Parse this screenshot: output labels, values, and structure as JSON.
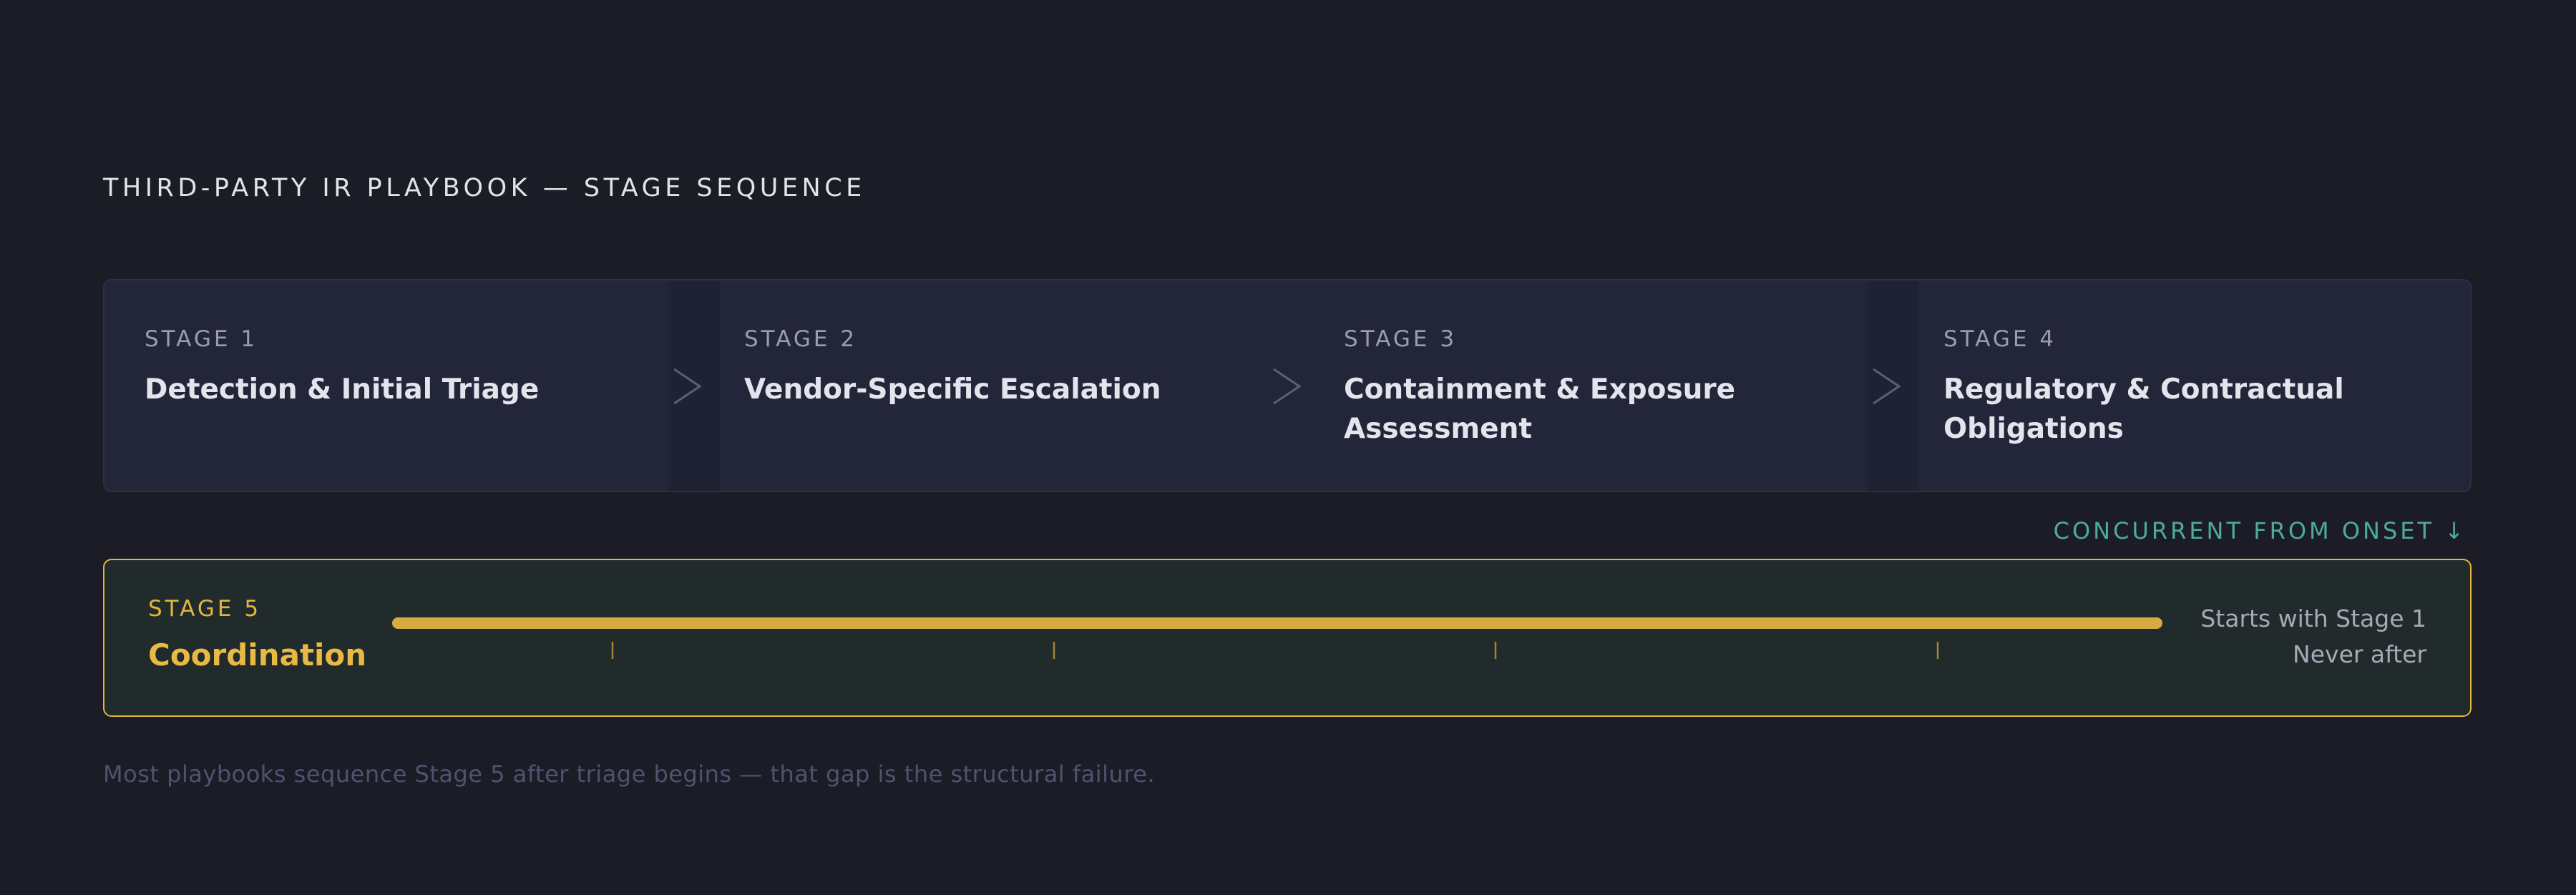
{
  "header": {
    "title": "THIRD-PARTY IR PLAYBOOK — STAGE SEQUENCE"
  },
  "stages": [
    {
      "number": "STAGE 1",
      "name": "Detection & Initial Triage"
    },
    {
      "number": "STAGE 2",
      "name": "Vendor-Specific Escalation"
    },
    {
      "number": "STAGE 3",
      "name": "Containment & Exposure Assessment"
    },
    {
      "number": "STAGE 4",
      "name": "Regulatory & Contractual Obligations"
    }
  ],
  "concurrent_label": "CONCURRENT FROM ONSET ↓",
  "stage5": {
    "number": "STAGE 5",
    "name": "Coordination",
    "note_line1": "Starts with Stage 1",
    "note_line2": "Never after"
  },
  "footnote": "Most playbooks sequence Stage 5 after triage begins — that gap is the structural failure.",
  "colors": {
    "background": "#1b1c26",
    "stage_panel": "#232639",
    "accent_gold": "#e3b63f",
    "accent_teal": "#4eaa9c",
    "stage5_panel": "#212b2b"
  },
  "icons": {
    "separator": "chevron-right-icon"
  }
}
